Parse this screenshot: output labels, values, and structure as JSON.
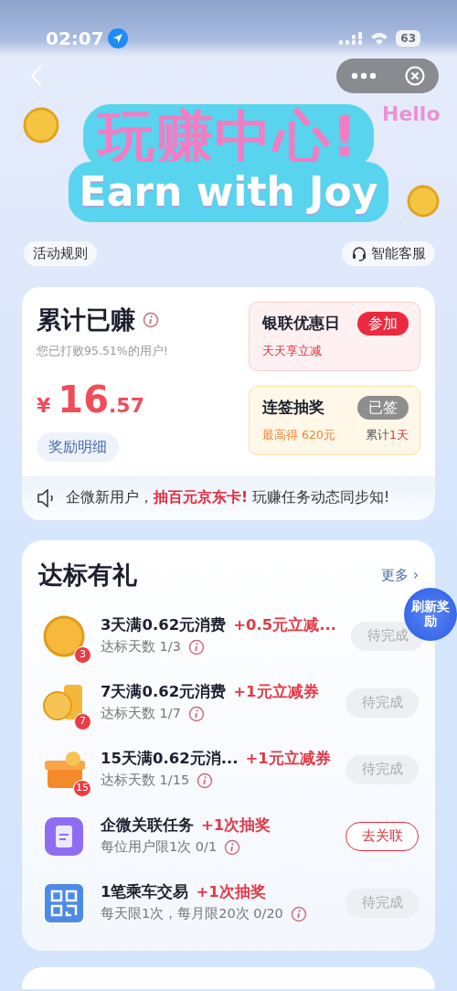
{
  "status_bar": {
    "time": "02:07",
    "battery": "63"
  },
  "banner": {
    "hello": "Hello",
    "title": "玩赚中心!",
    "subtitle": "Earn with Joy",
    "rules_link": "活动规则",
    "service_link": "智能客服"
  },
  "earnings": {
    "title": "累计已赚",
    "subtitle": "您已打败95.51%的用户!",
    "currency": "¥",
    "amount_int": "16",
    "amount_dec": ".57",
    "details_button": "奖励明细",
    "promos": [
      {
        "kind": "pink",
        "title": "银联优惠日",
        "button": "参加",
        "button_done": false,
        "note": "天天享立减"
      },
      {
        "kind": "yellow",
        "title": "连签抽奖",
        "button": "已签",
        "button_done": true,
        "note": "最高得 620元",
        "count_label": "累计",
        "count_value": "1天"
      }
    ]
  },
  "notice": {
    "text": "企微新用户，**抽百元京东卡!** 玩赚任务动态同步知!"
  },
  "tasks_section": {
    "title": "达标有礼",
    "more": "更多 ›",
    "refresh_badge": "刷新奖励",
    "tasks": [
      {
        "badge": "3",
        "title": "3天满0.62元消费",
        "reward": "+0.5元立减...",
        "limit": "达标天数 1/3",
        "button": "待完成",
        "disabled": true
      },
      {
        "badge": "7",
        "title": "7天满0.62元消费",
        "reward": "+1元立减券",
        "limit": "达标天数 1/7",
        "button": "待完成",
        "disabled": true
      },
      {
        "badge": "15",
        "title": "15天满0.62元消...",
        "reward": "+1元立减券",
        "limit": "达标天数 1/15",
        "button": "待完成",
        "disabled": true
      },
      {
        "title": "企微关联任务",
        "reward": "+1次抽奖",
        "limit": "每位用户限1次 0/1",
        "button": "去关联",
        "disabled": false
      },
      {
        "title": "1笔乘车交易",
        "reward": "+1次抽奖",
        "limit": "每天限1次，每月限20次 0/20",
        "button": "待完成",
        "disabled": true
      }
    ]
  }
}
